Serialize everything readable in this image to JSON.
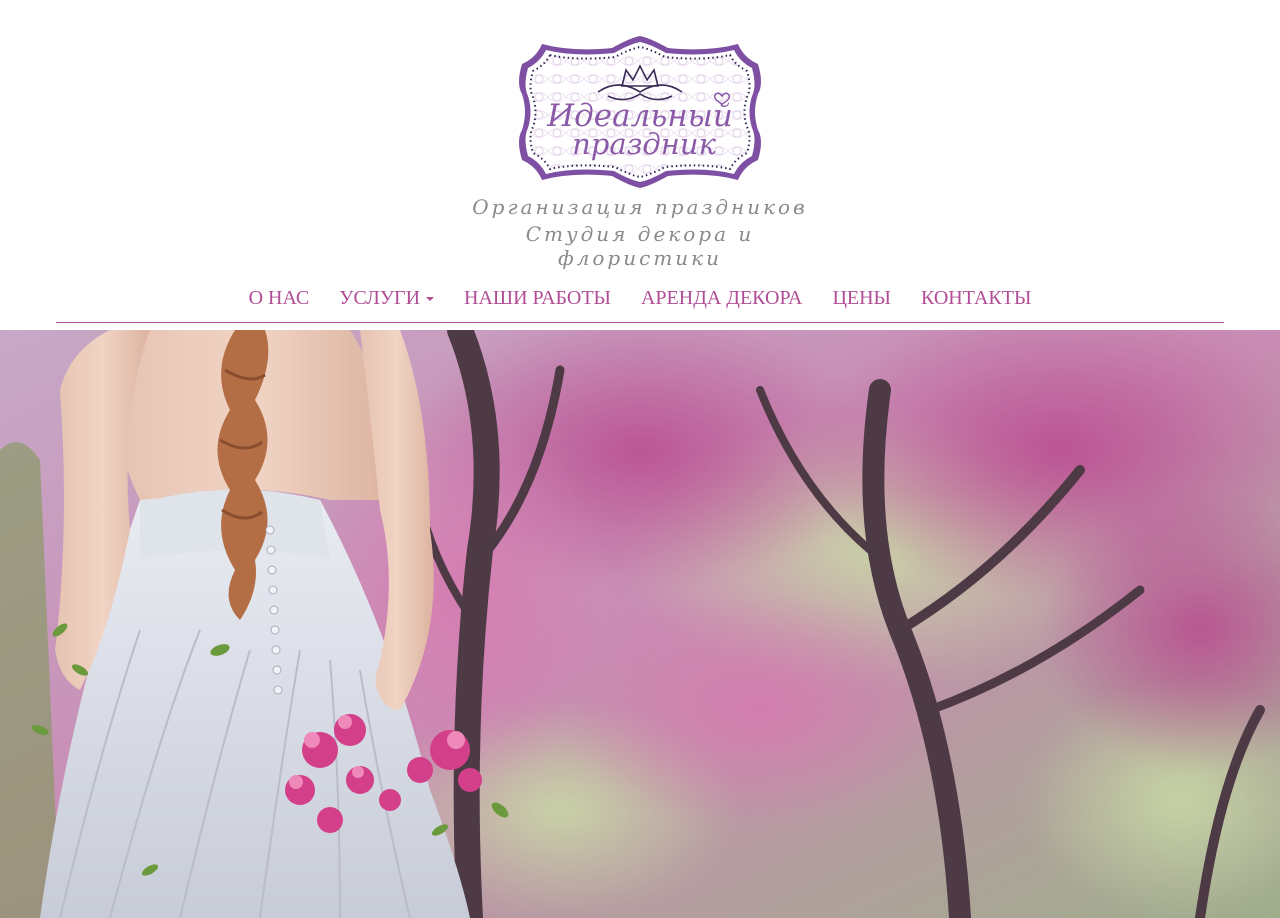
{
  "brand": {
    "logo_line1": "Идеальный",
    "logo_line2": "праздник",
    "tagline1": "Организация праздников",
    "tagline2": "Студия декора и флористики",
    "accent_color": "#b04d95",
    "logo_color": "#8a5aa8"
  },
  "nav": {
    "items": [
      {
        "label": "О НАС"
      },
      {
        "label": "УСЛУГИ",
        "has_dropdown": true
      },
      {
        "label": "НАШИ РАБОТЫ"
      },
      {
        "label": "АРЕНДА ДЕКОРА"
      },
      {
        "label": "ЦЕНЫ"
      },
      {
        "label": "КОНТАКТЫ"
      }
    ],
    "dropdown_icon": "caret-down-icon"
  },
  "hero": {
    "image": "bride-in-blossom-garden"
  }
}
